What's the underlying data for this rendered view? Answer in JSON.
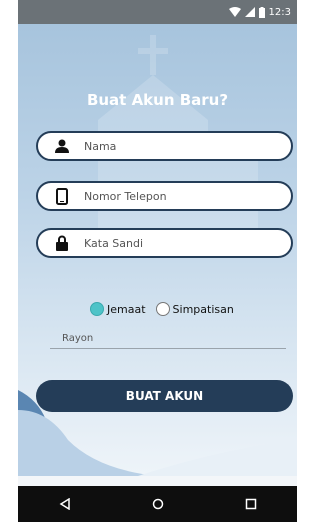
{
  "status_bar": {
    "time": "12:3"
  },
  "title": "Buat Akun Baru?",
  "fields": {
    "name_placeholder": "Nama",
    "phone_placeholder": "Nomor Telepon",
    "password_placeholder": "Kata Sandi"
  },
  "radios": {
    "option1": "Jemaat",
    "option2": "Simpatisan",
    "selected": "Jemaat"
  },
  "rayon_label": "Rayon",
  "button_label": "BUAT AKUN",
  "colors": {
    "primary": "#243d58",
    "accent": "#4ec3c8"
  }
}
